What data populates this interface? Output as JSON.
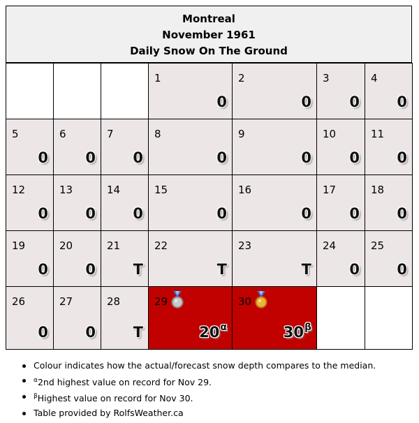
{
  "header": {
    "city": "Montreal",
    "month": "November 1961",
    "subtitle": "Daily Snow On The Ground"
  },
  "calendar": {
    "weeks": [
      [
        null,
        null,
        null,
        {
          "day": "1",
          "value": "0"
        },
        {
          "day": "2",
          "value": "0"
        },
        {
          "day": "3",
          "value": "0"
        },
        {
          "day": "4",
          "value": "0"
        }
      ],
      [
        {
          "day": "5",
          "value": "0"
        },
        {
          "day": "6",
          "value": "0"
        },
        {
          "day": "7",
          "value": "0"
        },
        {
          "day": "8",
          "value": "0"
        },
        {
          "day": "9",
          "value": "0"
        },
        {
          "day": "10",
          "value": "0"
        },
        {
          "day": "11",
          "value": "0"
        }
      ],
      [
        {
          "day": "12",
          "value": "0"
        },
        {
          "day": "13",
          "value": "0"
        },
        {
          "day": "14",
          "value": "0"
        },
        {
          "day": "15",
          "value": "0"
        },
        {
          "day": "16",
          "value": "0"
        },
        {
          "day": "17",
          "value": "0"
        },
        {
          "day": "18",
          "value": "0"
        }
      ],
      [
        {
          "day": "19",
          "value": "0"
        },
        {
          "day": "20",
          "value": "0"
        },
        {
          "day": "21",
          "value": "T"
        },
        {
          "day": "22",
          "value": "T"
        },
        {
          "day": "23",
          "value": "T"
        },
        {
          "day": "24",
          "value": "0"
        },
        {
          "day": "25",
          "value": "0"
        }
      ],
      [
        {
          "day": "26",
          "value": "0"
        },
        {
          "day": "27",
          "value": "0"
        },
        {
          "day": "28",
          "value": "T"
        },
        {
          "day": "29",
          "value": "20",
          "mark": "α",
          "medal": "silver",
          "highlight": true
        },
        {
          "day": "30",
          "value": "30",
          "mark": "β",
          "medal": "gold",
          "highlight": true
        },
        null,
        null
      ]
    ],
    "colors": {
      "normal": "#ede6e6",
      "blank": "#ffffff",
      "highlight": "#c10000",
      "header": "#f0f0f0"
    }
  },
  "notes": {
    "colour": "Colour indicates how the actual/forecast snow depth compares to the median.",
    "alpha_mark": "α",
    "alpha_text": "2nd highest value on record for Nov 29.",
    "beta_mark": "β",
    "beta_text": "Highest value on record for Nov 30.",
    "credit": "Table provided by RolfsWeather.ca"
  }
}
